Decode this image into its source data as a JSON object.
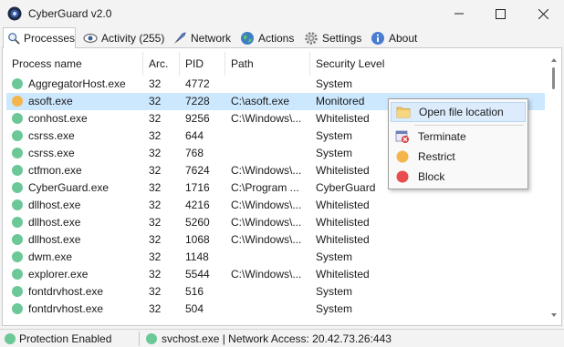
{
  "window": {
    "title": "CyberGuard v2.0"
  },
  "tabs": [
    {
      "label": "Processes",
      "icon": "magnifier-icon"
    },
    {
      "label": "Activity (255)",
      "icon": "eye-icon"
    },
    {
      "label": "Network",
      "icon": "rocket-icon"
    },
    {
      "label": "Actions",
      "icon": "globe-icon"
    },
    {
      "label": "Settings",
      "icon": "gear-icon"
    },
    {
      "label": "About",
      "icon": "info-icon"
    }
  ],
  "table": {
    "columns": [
      "Process name",
      "Arc.",
      "PID",
      "Path",
      "Security Level"
    ],
    "rows": [
      {
        "name": "AggregatorHost.exe",
        "arc": "32",
        "pid": "4772",
        "path": "",
        "level": "System",
        "status": "green"
      },
      {
        "name": "asoft.exe",
        "arc": "32",
        "pid": "7228",
        "path": "C:\\asoft.exe",
        "level": "Monitored",
        "status": "orange"
      },
      {
        "name": "conhost.exe",
        "arc": "32",
        "pid": "9256",
        "path": "C:\\Windows\\...",
        "level": "Whitelisted",
        "status": "green"
      },
      {
        "name": "csrss.exe",
        "arc": "32",
        "pid": "644",
        "path": "",
        "level": "System",
        "status": "green"
      },
      {
        "name": "csrss.exe",
        "arc": "32",
        "pid": "768",
        "path": "",
        "level": "System",
        "status": "green"
      },
      {
        "name": "ctfmon.exe",
        "arc": "32",
        "pid": "7624",
        "path": "C:\\Windows\\...",
        "level": "Whitelisted",
        "status": "green"
      },
      {
        "name": "CyberGuard.exe",
        "arc": "32",
        "pid": "1716",
        "path": "C:\\Program ...",
        "level": "CyberGuard",
        "status": "green"
      },
      {
        "name": "dllhost.exe",
        "arc": "32",
        "pid": "4216",
        "path": "C:\\Windows\\...",
        "level": "Whitelisted",
        "status": "green"
      },
      {
        "name": "dllhost.exe",
        "arc": "32",
        "pid": "5260",
        "path": "C:\\Windows\\...",
        "level": "Whitelisted",
        "status": "green"
      },
      {
        "name": "dllhost.exe",
        "arc": "32",
        "pid": "1068",
        "path": "C:\\Windows\\...",
        "level": "Whitelisted",
        "status": "green"
      },
      {
        "name": "dwm.exe",
        "arc": "32",
        "pid": "1148",
        "path": "",
        "level": "System",
        "status": "green"
      },
      {
        "name": "explorer.exe",
        "arc": "32",
        "pid": "5544",
        "path": "C:\\Windows\\...",
        "level": "Whitelisted",
        "status": "green"
      },
      {
        "name": "fontdrvhost.exe",
        "arc": "32",
        "pid": "516",
        "path": "",
        "level": "System",
        "status": "green"
      },
      {
        "name": "fontdrvhost.exe",
        "arc": "32",
        "pid": "504",
        "path": "",
        "level": "System",
        "status": "green"
      }
    ],
    "selected_index": 1
  },
  "context_menu": {
    "items": [
      {
        "label": "Open file location",
        "icon": "folder-icon"
      },
      {
        "label": "Terminate",
        "icon": "terminate-icon"
      },
      {
        "label": "Restrict",
        "icon": "orange-circle-icon"
      },
      {
        "label": "Block",
        "icon": "red-circle-icon"
      }
    ]
  },
  "statusbar": {
    "protection": "Protection Enabled",
    "network": "svchost.exe | Network Access: 20.42.73.26:443"
  },
  "colors": {
    "green": "#6cc896",
    "orange": "#f5b54d",
    "red": "#e84c4c",
    "selected_row": "#cce8ff",
    "menu_hover": "#dcecfc"
  }
}
